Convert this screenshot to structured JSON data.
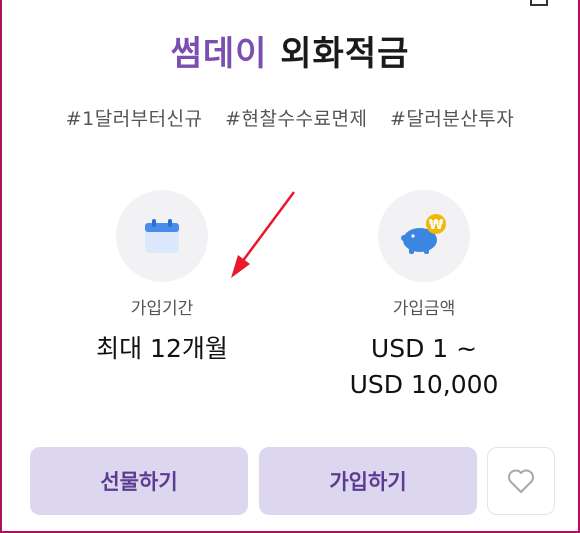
{
  "product": {
    "brand": "썸데이",
    "title_rest": "외화적금"
  },
  "tags": [
    "#1달러부터신규",
    "#현찰수수료면제",
    "#달러분산투자"
  ],
  "info": {
    "period": {
      "label": "가입기간",
      "value": "최대 12개월",
      "icon": "calendar-icon"
    },
    "amount": {
      "label": "가입금액",
      "value_line1": "USD 1 ~",
      "value_line2": "USD 10,000",
      "icon": "piggy-bank-icon"
    }
  },
  "buttons": {
    "gift_label": "선물하기",
    "join_label": "가입하기",
    "favorite_icon": "heart-icon"
  },
  "colors": {
    "brand": "#7b4fb0",
    "button_bg": "#dcd7ee",
    "button_text": "#5c3c93",
    "annotation_arrow": "#e8192c",
    "frame_border": "#b0105c"
  }
}
